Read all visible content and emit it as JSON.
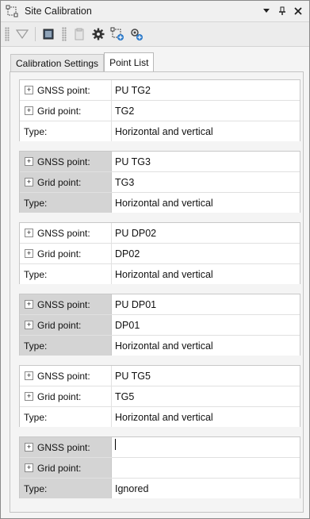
{
  "window": {
    "title": "Site Calibration"
  },
  "title_buttons": {
    "menu": "▼",
    "pin": "📌",
    "close": "✕"
  },
  "tabs": [
    {
      "label": "Calibration Settings",
      "active": false
    },
    {
      "label": "Point List",
      "active": true
    }
  ],
  "labels": {
    "gnss": "GNSS point:",
    "grid": "Grid point:",
    "type": "Type:"
  },
  "points": [
    {
      "gnss": "PU TG2",
      "grid": "TG2",
      "type": "Horizontal and vertical"
    },
    {
      "gnss": "PU TG3",
      "grid": "TG3",
      "type": "Horizontal and vertical"
    },
    {
      "gnss": "PU DP02",
      "grid": "DP02",
      "type": "Horizontal and vertical"
    },
    {
      "gnss": "PU DP01",
      "grid": "DP01",
      "type": "Horizontal and vertical"
    },
    {
      "gnss": "PU TG5",
      "grid": "TG5",
      "type": "Horizontal and vertical"
    },
    {
      "gnss": "",
      "grid": "",
      "type": "Ignored"
    }
  ],
  "colors": {
    "shaded_label": "#d4d4d4",
    "panel": "#f4f4f4"
  }
}
